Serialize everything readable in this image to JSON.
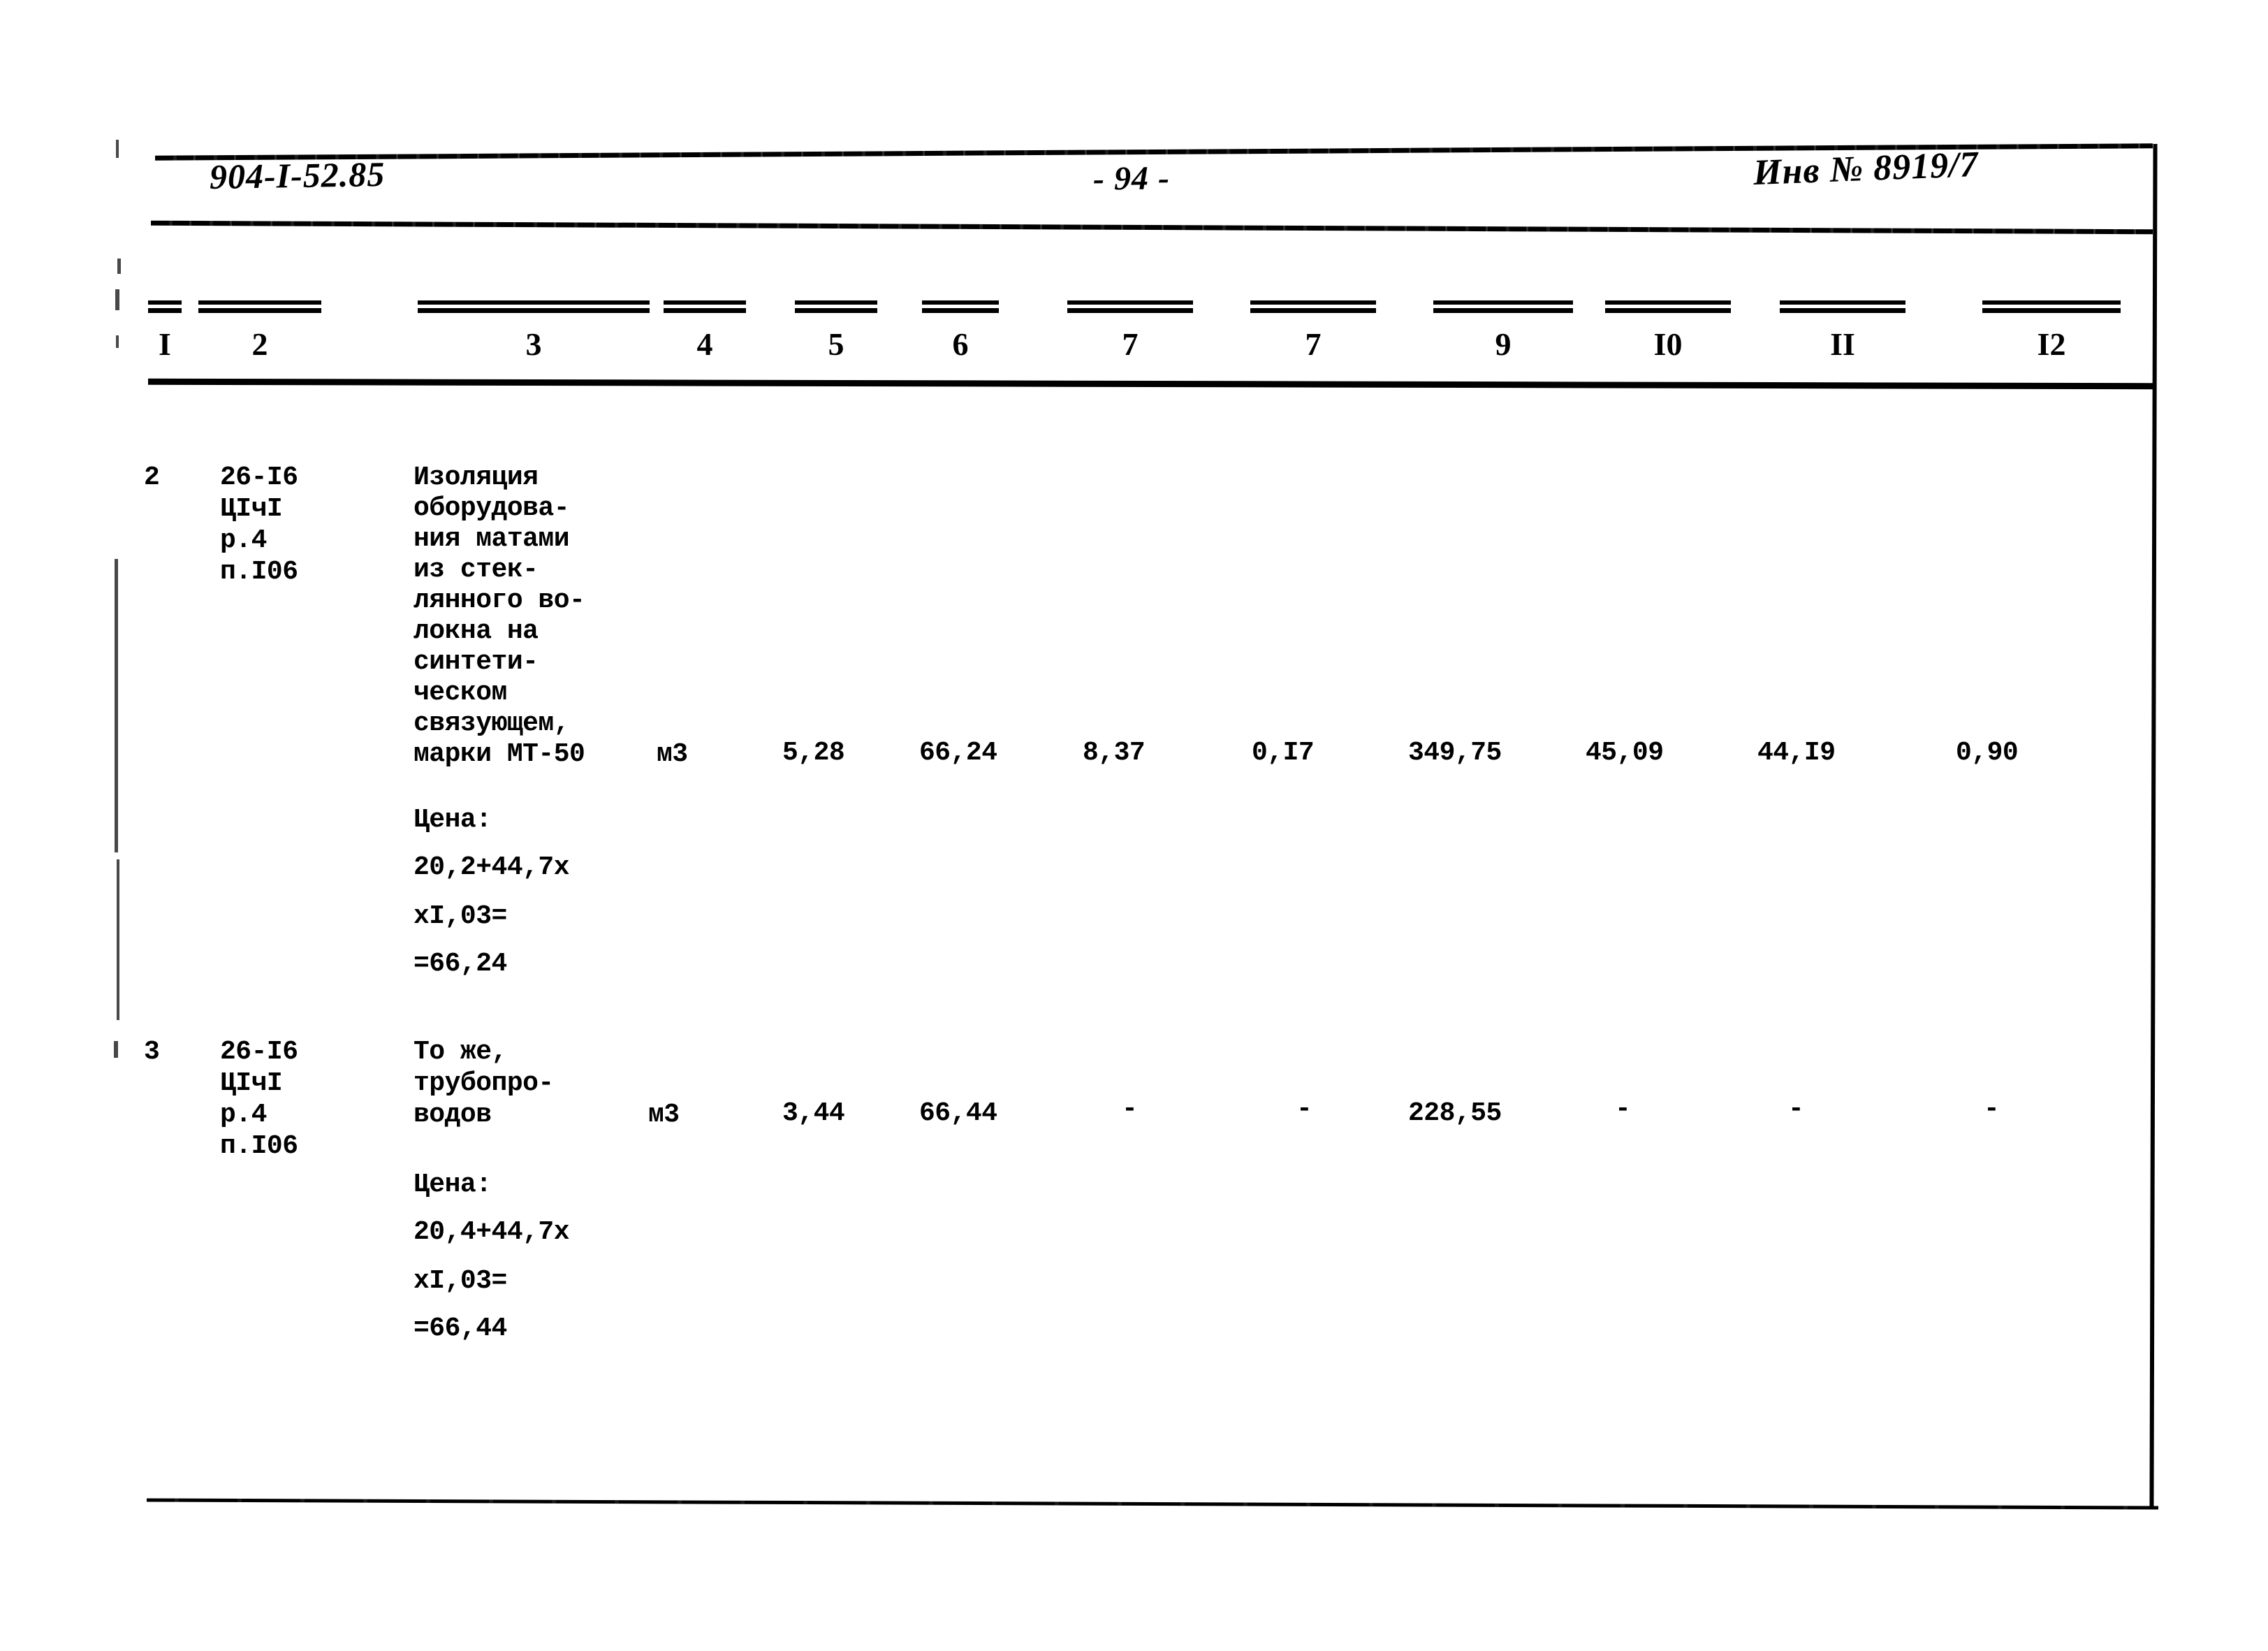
{
  "document": {
    "code": "904-I-52.85",
    "page_label": "- 94 -",
    "inventory": "Инв № 8919/7"
  },
  "table": {
    "column_headers": [
      "I",
      "2",
      "3",
      "4",
      "5",
      "6",
      "7",
      "7",
      "9",
      "I0",
      "II",
      "I2"
    ],
    "rows": [
      {
        "position": "2",
        "code_lines": [
          "26-I6",
          "ЦIчI",
          "р.4",
          "п.I06"
        ],
        "description_lines": [
          "Изоляция",
          "оборудова-",
          "ния матами",
          "из стек-",
          "лянного во-",
          "локна на",
          "синтети-",
          "ческом",
          "связующем,",
          "марки МТ-50"
        ],
        "price_note_lines": [
          "Цена:",
          "20,2+44,7х",
          "хI,03=",
          "=66,24"
        ],
        "unit": "м3",
        "values": [
          "5,28",
          "66,24",
          "8,37",
          "0,I7",
          "349,75",
          "45,09",
          "44,I9",
          "0,90"
        ]
      },
      {
        "position": "3",
        "code_lines": [
          "26-I6",
          "ЦIчI",
          "р.4",
          "п.I06"
        ],
        "description_lines": [
          "То же,",
          "трубопро-",
          "водов"
        ],
        "price_note_lines": [
          "Цена:",
          "20,4+44,7х",
          "хI,03=",
          "=66,44"
        ],
        "unit": "м3",
        "values": [
          "3,44",
          "66,44",
          "-",
          "-",
          "228,55",
          "-",
          "-",
          "-"
        ]
      }
    ]
  }
}
